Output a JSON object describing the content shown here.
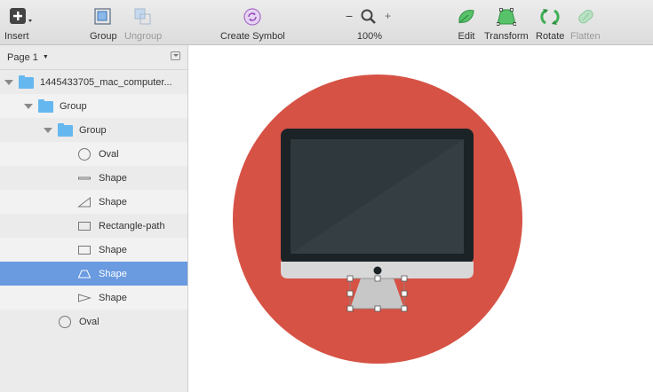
{
  "toolbar": {
    "insert": "Insert",
    "group": "Group",
    "ungroup": "Ungroup",
    "create_symbol": "Create Symbol",
    "zoom": "100%",
    "zoom_minus": "−",
    "zoom_plus": "+",
    "edit": "Edit",
    "transform": "Transform",
    "rotate": "Rotate",
    "flatten": "Flatten"
  },
  "sidebar": {
    "page": "Page 1",
    "layers": [
      {
        "name": "1445433705_mac_computer...",
        "kind": "folder"
      },
      {
        "name": "Group",
        "kind": "folder"
      },
      {
        "name": "Group",
        "kind": "folder"
      },
      {
        "name": "Oval",
        "kind": "oval"
      },
      {
        "name": "Shape",
        "kind": "line"
      },
      {
        "name": "Shape",
        "kind": "triangle"
      },
      {
        "name": "Rectangle-path",
        "kind": "rect"
      },
      {
        "name": "Shape",
        "kind": "rect"
      },
      {
        "name": "Shape",
        "kind": "trapezoid",
        "selected": true
      },
      {
        "name": "Shape",
        "kind": "arrow"
      },
      {
        "name": "Oval",
        "kind": "oval"
      }
    ]
  },
  "colors": {
    "accent_selection": "#6a9ae0",
    "circle": "#d65245",
    "bezel": "#1b2327",
    "screen": "#2f383d",
    "chin": "#d8d8d8",
    "stand": "#c7c7c7",
    "folder": "#65b7ef"
  }
}
